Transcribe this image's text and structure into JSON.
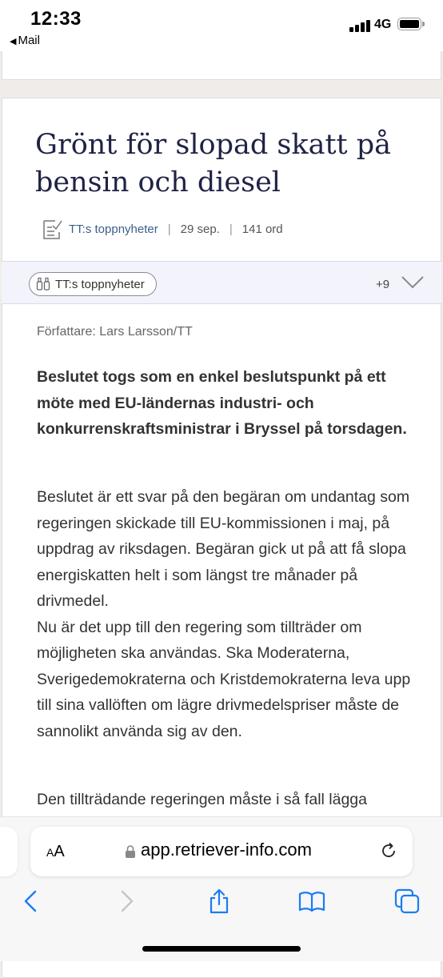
{
  "status_bar": {
    "time": "12:33",
    "back_app": "Mail",
    "network": "4G"
  },
  "article": {
    "title": "Grönt för slopad skatt på bensin och diesel",
    "source": "TT:s toppnyheter",
    "date": "29 sep.",
    "word_count": "141 ord",
    "tag": "TT:s toppnyheter",
    "more_tags": "+9",
    "author": "Författare: Lars Larsson/TT",
    "lead": "Beslutet togs som en enkel beslutspunkt på ett möte med EU-ländernas industri- och konkurrenskraftsministrar i Bryssel på torsdagen.",
    "paragraph_1a": "Beslutet är ett svar på den begäran om undantag som regeringen skickade till EU-kommissionen i maj, på uppdrag av riksdagen. Begäran gick ut på att få slopa energiskatten helt i som längst tre månader på drivmedel.",
    "paragraph_1b": "Nu är det upp till den regering som tillträder om möjligheten ska användas. Ska Moderaterna, Sverigedemokraterna och Kristdemokraterna leva upp till sina vallöften om lägre drivmedelspriser måste de sannolikt använda sig av den.",
    "paragraph_2": "Den tillträdande regeringen måste i så fall lägga"
  },
  "browser": {
    "text_size_label": "AA",
    "url": "app.retriever-info.com"
  },
  "icons": {
    "back": "chevron-left-icon",
    "forward": "chevron-right-icon",
    "share": "share-icon",
    "bookmarks": "book-icon",
    "tabs": "tabs-icon"
  },
  "colors": {
    "accent": "#1a7cf5",
    "title": "#1f2345",
    "source_link": "#3b5f8a"
  }
}
